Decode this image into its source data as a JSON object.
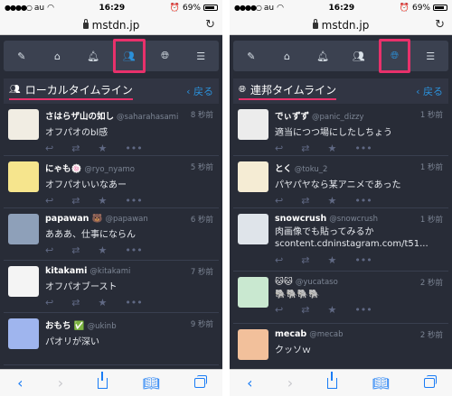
{
  "status": {
    "carrier": "au",
    "time": "16:29",
    "battery": "69%",
    "battery_level": 0.69
  },
  "browser": {
    "url": "mstdn.jp"
  },
  "nav": {
    "icons": [
      "pencil-icon",
      "home-icon",
      "bell-icon",
      "people-icon",
      "globe-icon",
      "menu-icon"
    ]
  },
  "left": {
    "column_title": "ローカルタイムライン",
    "back_label": "戻る",
    "toots": [
      {
        "name": "さはらザ山の如し",
        "acct": "@saharahasami",
        "time": "8 秒前",
        "text": "オフパオのbl感",
        "avatar": "#f1ede3"
      },
      {
        "name": "にゃも🍥",
        "acct": "@ryo_nyamo",
        "time": "5 秒前",
        "text": "オフパオいいなあー",
        "avatar": "#f6e58d"
      },
      {
        "name": "papawan 🐻",
        "acct": "@papawan",
        "time": "6 秒前",
        "text": "あああ、仕事にならん",
        "avatar": "#8ea0b9"
      },
      {
        "name": "kitakami",
        "acct": "@kitakami",
        "time": "7 秒前",
        "text": "オフパオブースト",
        "avatar": "#f4f4f4"
      },
      {
        "name": "おもち ✅",
        "acct": "@ukinb",
        "time": "9 秒前",
        "text": "パオリが深い",
        "avatar": "#9fb5ee"
      }
    ]
  },
  "right": {
    "column_title": "連邦タイムライン",
    "back_label": "戻る",
    "toots": [
      {
        "name": "でぃずず",
        "acct": "@panic_dizzy",
        "time": "1 秒前",
        "text": "適当につつ場にしたしちょう",
        "avatar": "#ececec"
      },
      {
        "name": "とく",
        "acct": "@toku_2",
        "time": "1 秒前",
        "text": "パヤパヤなら某アニメであった",
        "avatar": "#f5ecd4"
      },
      {
        "name": "snowcrush",
        "acct": "@snowcrush",
        "time": "1 秒前",
        "text": "肉画像でも貼ってみるか scontent.cdninstagram.com/t51...",
        "avatar": "#dfe4ea"
      },
      {
        "name": "🐱🐱",
        "acct": "@yucataso",
        "time": "2 秒前",
        "text": "🐘🐘🐘🐘",
        "avatar": "#c9e8d0"
      },
      {
        "name": "mecab",
        "acct": "@mecab",
        "time": "2 秒前",
        "text": "クッソｗ",
        "avatar": "#f2c09b"
      }
    ]
  },
  "colors": {
    "accent": "#2b90d9",
    "highlight": "#e8316b",
    "background": "#282c37"
  }
}
